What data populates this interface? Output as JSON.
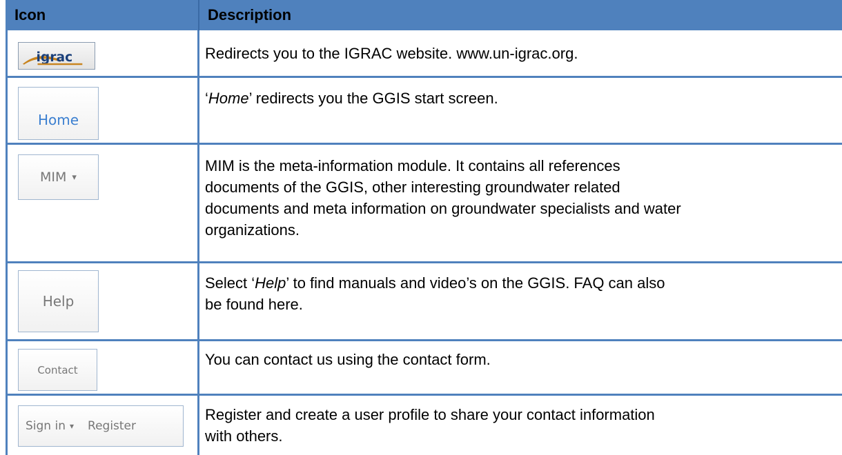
{
  "table": {
    "header": {
      "icon": "Icon",
      "description": "Description"
    },
    "rows": [
      {
        "icon": {
          "type": "logo",
          "text": "igrac",
          "icon_name": "igrac-logo"
        },
        "description": "Redirects you to the IGRAC website. www.un-igrac.org."
      },
      {
        "icon": {
          "type": "button",
          "text": "Home"
        },
        "description": {
          "q1": "‘",
          "em": "Home",
          "rest": "’ redirects you the GGIS start screen."
        }
      },
      {
        "icon": {
          "type": "dropdown-button",
          "text": "MIM",
          "caret": "▾"
        },
        "description": [
          "MIM is the meta-information module. It contains all references",
          "documents of the GGIS, other interesting groundwater related",
          "documents and meta information on groundwater specialists and water",
          "organizations."
        ]
      },
      {
        "icon": {
          "type": "button",
          "text": "Help"
        },
        "description": {
          "pre": "Select ‘",
          "em": "Help",
          "post": "’ to find manuals and video’s on the GGIS. FAQ can also",
          "line2": "be found here."
        }
      },
      {
        "icon": {
          "type": "button",
          "text": "Contact"
        },
        "description": "You can contact us using the contact form."
      },
      {
        "icon": {
          "type": "split-button",
          "left": "Sign in",
          "caret": "▾",
          "right": "Register"
        },
        "description": [
          "Register and create a user profile to share your contact information",
          "with others."
        ]
      }
    ]
  },
  "colors": {
    "header_bg": "#4f81bd",
    "border": "#4f81bd",
    "logo_orange": "#c8841f",
    "logo_blue": "#1a3f7a",
    "home_link": "#3b7fd0"
  }
}
